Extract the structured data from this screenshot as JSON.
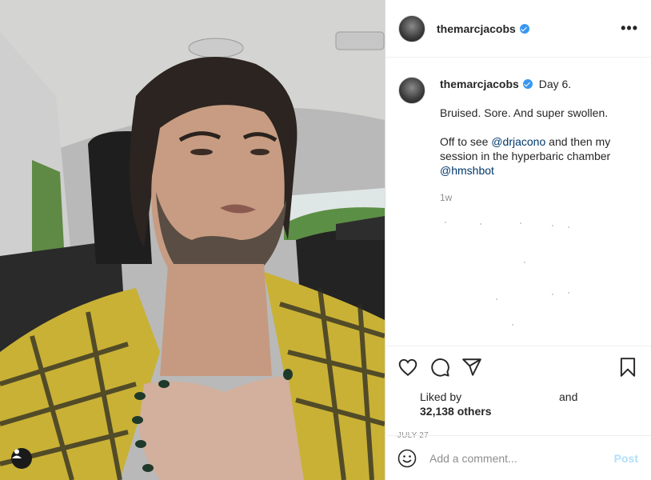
{
  "post": {
    "image_alt": "Selfie in a car",
    "username": "themarcjacobs"
  },
  "header": {
    "username": "themarcjacobs",
    "verified_icon": "verified-badge-icon",
    "more_icon": "more-options-icon",
    "more_label": "•••"
  },
  "caption": {
    "username": "themarcjacobs",
    "line1": "Day 6.",
    "line2": "Bruised. Sore. And super swollen.",
    "line3_pre": "Off to see ",
    "mention1": "@drjacono",
    "line3_post": " and then my session in the hyperbaric chamber",
    "mention2": "@hmshbot",
    "age": "1w"
  },
  "actions": {
    "like_icon": "heart-icon",
    "comment_icon": "comment-icon",
    "share_icon": "share-icon",
    "save_icon": "bookmark-icon",
    "liked_by": "Liked by",
    "and": "and",
    "count": "32,138 others",
    "date": "JULY 27"
  },
  "comment": {
    "placeholder": "Add a comment...",
    "post_label": "Post",
    "emoji_icon": "emoji-icon"
  },
  "colors": {
    "verified": "#3897f0",
    "link": "#00376b",
    "muted": "#8e8e8e",
    "post_disabled": "#b2dffc"
  }
}
